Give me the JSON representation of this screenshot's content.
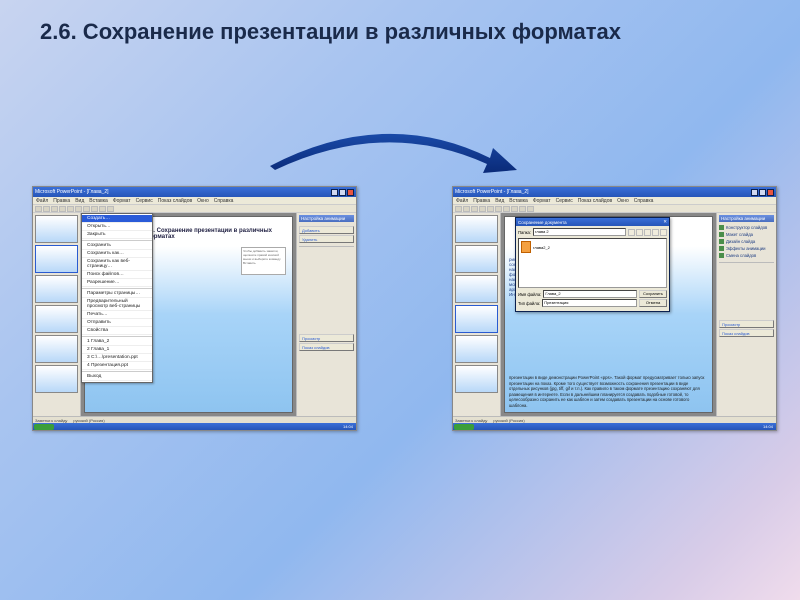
{
  "slide": {
    "title": "2.6. Сохранение презентации в различных форматах"
  },
  "app": {
    "titlebar": "Microsoft PowerPoint - [Глава_2]",
    "menu": [
      "Файл",
      "Правка",
      "Вид",
      "Вставка",
      "Формат",
      "Сервис",
      "Показ слайдов",
      "Окно",
      "Справка"
    ]
  },
  "file_menu": {
    "items": [
      "Создать…",
      "Открыть…",
      "Закрыть",
      "Сохранить",
      "Сохранить как…",
      "Сохранить как веб-страницу…",
      "Поиск файлов…",
      "Разрешение…",
      "Параметры страницы…",
      "Предварительный просмотр веб-страницы",
      "Печать…",
      "Отправить",
      "Свойства",
      "1 Глава_2",
      "2 Глава_1",
      "3 C:\\…\\presentation.ppt",
      "4 Презентация.ppt",
      "Выход"
    ],
    "highlight_index": 0
  },
  "inner_slide": {
    "title_left": "2.6. Сохранение презентации в различных форматах",
    "hint_box": "Чтобы добавить заметки, щелкните правой кнопкой мыши и выберите команду Вставить",
    "body_right": "презентации в виде демонстрации PowerPoint «pps». Такой формат предусматривает только запуск презентации на показ.\nКроме того существует возможность сохранения презентации в виде отдельных рисунков (jpg, tiff, gif и т.п.). Как правило в таком формате презентацию сохраняют для размещения в интернете.\nЕсли в дальнейшем планируется создавать подобные готовой, то целесообразно сохранить ее как шаблон и затем создавать презентации на основе готового шаблона.",
    "side_fragment": "рисун\nсохра\nналич\nформа\nналич\nможет\nархив\nИнтер"
  },
  "save_dialog": {
    "title": "Сохранение документа",
    "folder_label": "Папка:",
    "folder_value": "глава 2",
    "file_item": "глава2_2",
    "filename_label": "Имя файла:",
    "filename_value": "Глава_2",
    "type_label": "Тип файла:",
    "type_value": "Презентация",
    "save_btn": "Сохранить",
    "cancel_btn": "Отмена"
  },
  "task_pane": {
    "header": "Настройка анимации",
    "links": [
      "Конструктор слайдов",
      "Макет слайда",
      "Дизайн слайда",
      "Эффекты анимации",
      "Смена слайдов"
    ],
    "btn_add": "Добавить",
    "btn_remove": "Удалить",
    "btn_play": "Просмотр",
    "btn_show": "Показ слайдов"
  },
  "statusbar": {
    "left": "Заметки к слайду",
    "mode": "русский (Россия)"
  },
  "taskbar": {
    "time": "14:04"
  }
}
